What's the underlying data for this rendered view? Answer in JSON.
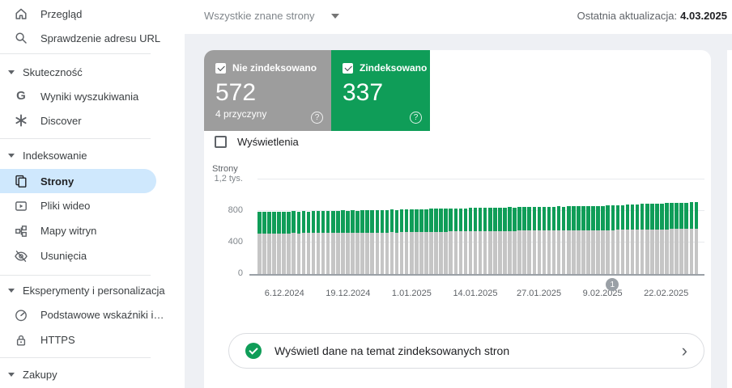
{
  "topbar": {
    "scope_selector": "Wszystkie znane strony",
    "last_update_label": "Ostatnia aktualizacja:",
    "last_update_date": "4.03.2025"
  },
  "sidebar": {
    "top_items": [
      {
        "label": "Przegląd",
        "icon": "home-icon"
      },
      {
        "label": "Sprawdzenie adresu URL",
        "icon": "search-icon"
      }
    ],
    "groups": [
      {
        "header": "Skuteczność",
        "items": [
          {
            "label": "Wyniki wyszukiwania",
            "icon": "google-g-icon"
          },
          {
            "label": "Discover",
            "icon": "discover-asterisk-icon"
          }
        ]
      },
      {
        "header": "Indeksowanie",
        "items": [
          {
            "label": "Strony",
            "icon": "pages-icon",
            "selected": true
          },
          {
            "label": "Pliki wideo",
            "icon": "video-icon"
          },
          {
            "label": "Mapy witryn",
            "icon": "sitemap-icon"
          },
          {
            "label": "Usunięcia",
            "icon": "visibility-off-icon"
          }
        ]
      },
      {
        "header": "Eksperymenty i personalizacja",
        "items": [
          {
            "label": "Podstawowe wskaźniki i…",
            "icon": "speed-gauge-icon"
          },
          {
            "label": "HTTPS",
            "icon": "lock-icon"
          }
        ]
      },
      {
        "header": "Zakupy",
        "items": []
      }
    ]
  },
  "summary_cards": {
    "not_indexed": {
      "label": "Nie zindeksowano",
      "value": "572",
      "sub": "4 przyczyny",
      "color": "#9d9d9d",
      "checked": true
    },
    "indexed": {
      "label": "Zindeksowano",
      "value": "337",
      "color": "#0f9d58",
      "checked": true
    }
  },
  "impressions_toggle": {
    "label": "Wyświetlenia",
    "checked": false
  },
  "chart_data": {
    "type": "bar",
    "stacked": true,
    "title": "Strony",
    "ylabel": "Strony",
    "ymax": 1200,
    "yticks": [
      {
        "label": "1,2 tys.",
        "value": 1200
      },
      {
        "label": "800",
        "value": 800
      },
      {
        "label": "400",
        "value": 400
      },
      {
        "label": "0",
        "value": 0
      }
    ],
    "start_date": "1.12.2024",
    "end_date": "28.02.2025",
    "xticks": [
      {
        "label": "6.12.2024",
        "day": 5
      },
      {
        "label": "19.12.2024",
        "day": 18
      },
      {
        "label": "1.01.2025",
        "day": 31
      },
      {
        "label": "14.01.2025",
        "day": 44
      },
      {
        "label": "27.01.2025",
        "day": 57
      },
      {
        "label": "9.02.2025",
        "day": 70
      },
      {
        "label": "22.02.2025",
        "day": 83
      }
    ],
    "marker": {
      "label": "1",
      "day": 72,
      "color": "#9aa0a6"
    },
    "series": [
      {
        "name": "Nie zindeksowano",
        "bar_color": "#c5c5c5",
        "values": [
          515,
          516,
          515,
          517,
          516,
          518,
          517,
          519,
          518,
          520,
          519,
          521,
          520,
          522,
          521,
          523,
          522,
          524,
          523,
          525,
          524,
          526,
          525,
          527,
          526,
          528,
          527,
          529,
          528,
          530,
          530,
          531,
          532,
          533,
          534,
          535,
          536,
          537,
          538,
          539,
          540,
          541,
          542,
          543,
          544,
          545,
          545,
          546,
          546,
          547,
          547,
          548,
          548,
          549,
          549,
          550,
          550,
          551,
          551,
          552,
          552,
          553,
          553,
          554,
          554,
          555,
          555,
          556,
          556,
          557,
          557,
          558,
          559,
          560,
          561,
          562,
          563,
          564,
          565,
          566,
          567,
          568,
          568,
          569,
          570,
          570,
          571,
          571,
          572,
          572
        ]
      },
      {
        "name": "Zindeksowano",
        "bar_color": "#0f9d58",
        "values": [
          272,
          274,
          271,
          275,
          273,
          276,
          274,
          277,
          275,
          278,
          276,
          279,
          277,
          280,
          278,
          281,
          279,
          282,
          280,
          283,
          281,
          284,
          282,
          285,
          283,
          286,
          284,
          287,
          285,
          288,
          287,
          289,
          288,
          290,
          289,
          291,
          290,
          292,
          291,
          293,
          292,
          294,
          293,
          295,
          294,
          296,
          295,
          297,
          296,
          298,
          297,
          299,
          298,
          300,
          299,
          301,
          300,
          302,
          301,
          303,
          302,
          304,
          303,
          305,
          304,
          306,
          305,
          307,
          306,
          308,
          308,
          310,
          312,
          314,
          316,
          318,
          320,
          322,
          324,
          326,
          327,
          328,
          329,
          330,
          331,
          332,
          333,
          334,
          336,
          337
        ]
      }
    ]
  },
  "footer_link": {
    "label": "Wyświetl dane na temat zindeksowanych stron"
  }
}
